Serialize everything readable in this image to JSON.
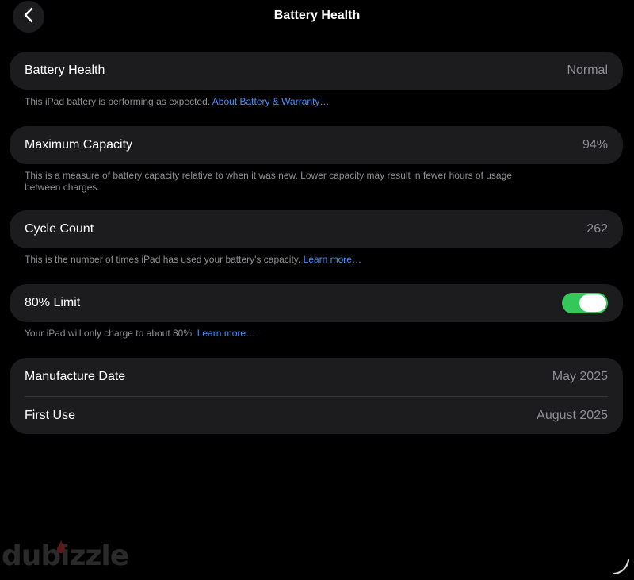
{
  "nav": {
    "back_icon": "chevron-left-icon",
    "title": "Battery Health"
  },
  "battery_health": {
    "label": "Battery Health",
    "value": "Normal",
    "note": "This iPad battery is performing as expected.",
    "note_link": "About Battery & Warranty…"
  },
  "max_capacity": {
    "label": "Maximum Capacity",
    "value": "94%",
    "note": "This is a measure of battery capacity relative to when it was new. Lower capacity may result in fewer hours of usage between charges."
  },
  "cycle_count": {
    "label": "Cycle Count",
    "value": "262",
    "note": "This is the number of times iPad has used your battery's capacity.",
    "note_link": "Learn more…"
  },
  "limit": {
    "label": "80% Limit",
    "enabled": true,
    "note": "Your iPad will only charge to about 80%.",
    "note_link": "Learn more…"
  },
  "dates": {
    "manufacture_label": "Manufacture Date",
    "manufacture_value": "May 2025",
    "first_use_label": "First Use",
    "first_use_value": "August 2025"
  },
  "watermark": {
    "text": "dubizzle"
  },
  "colors": {
    "background": "#000000",
    "card": "#1c1c1e",
    "accent_link": "#4a8df7",
    "toggle_on": "#34c759",
    "secondary_text": "#8e8e93"
  }
}
